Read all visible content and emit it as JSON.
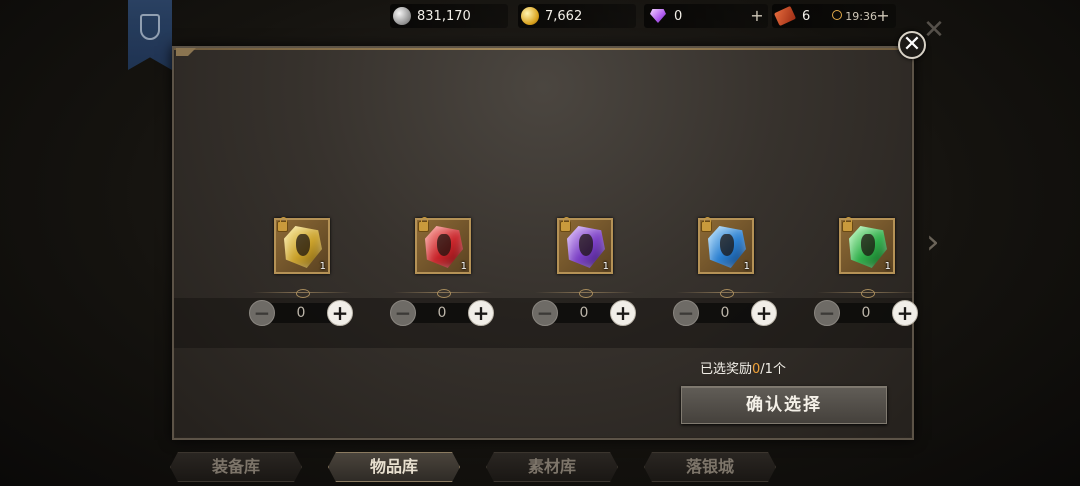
{
  "topbar": {
    "silver": "831,170",
    "gold": "7,662",
    "diamonds": "0",
    "tickets": "6",
    "time": "19:36"
  },
  "items": [
    {
      "count": "1",
      "color": "#c9a02a",
      "value": "0"
    },
    {
      "count": "1",
      "color": "#c8242a",
      "value": "0"
    },
    {
      "count": "1",
      "color": "#7a3fc4",
      "value": "0"
    },
    {
      "count": "1",
      "color": "#2a7fd0",
      "value": "0"
    },
    {
      "count": "1",
      "color": "#2fae4a",
      "value": "0"
    }
  ],
  "selection": {
    "prefix": "已选奖励",
    "selected": "0",
    "suffix": "/1个"
  },
  "confirm_label": "确认选择",
  "tabs": [
    {
      "label": "装备库",
      "active": false
    },
    {
      "label": "物品库",
      "active": true
    },
    {
      "label": "素材库",
      "active": false
    },
    {
      "label": "落银城",
      "active": false
    }
  ]
}
